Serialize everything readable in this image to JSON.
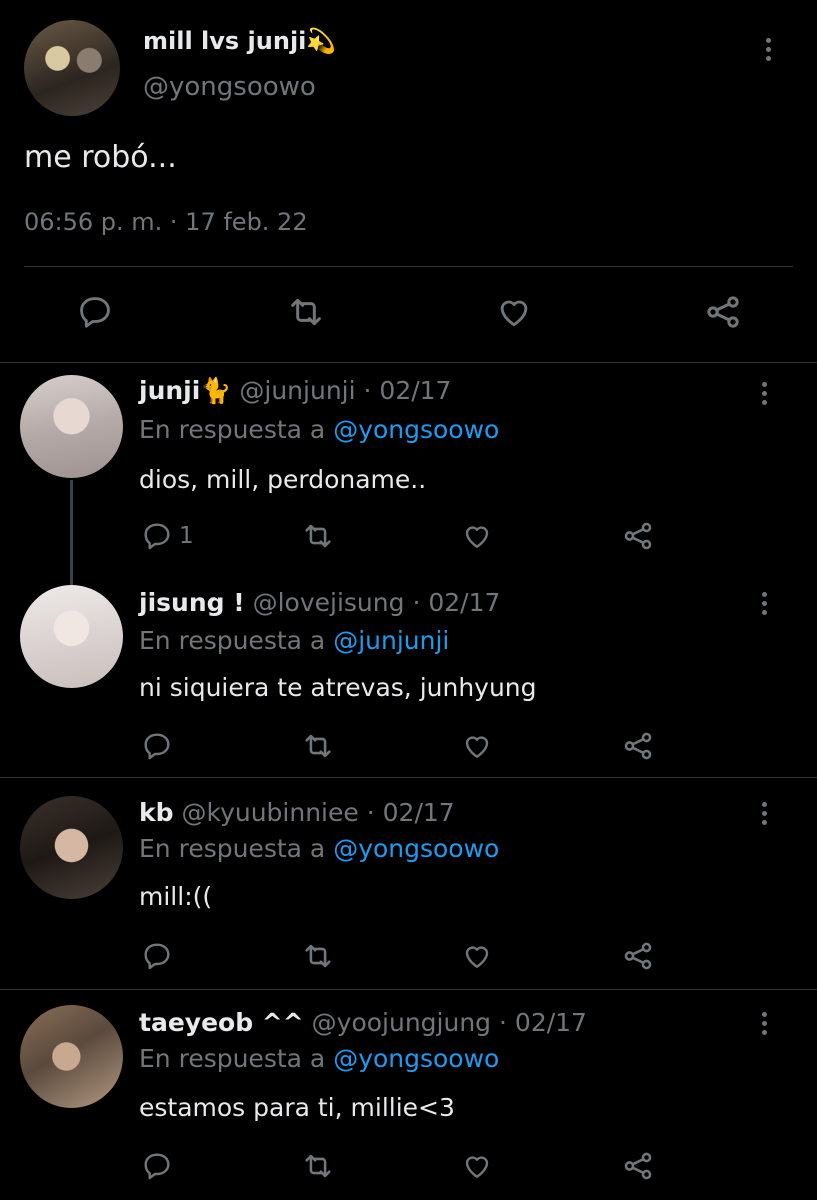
{
  "main_tweet": {
    "display_name": "mill lvs junji💫",
    "handle": "@yongsoowo",
    "text": "me robó...",
    "timestamp": "06:56 p. m. · 17 feb. 22",
    "actions": [
      "reply-icon",
      "retweet-icon",
      "like-icon",
      "share-icon"
    ]
  },
  "replies": [
    {
      "name": "junji🐈",
      "handle": "@junjunji",
      "date": "· 02/17",
      "in_reply_label": "En respuesta a",
      "in_reply_to": "@yongsoowo",
      "text": "dios, mill, perdoname..",
      "reply_count": "1"
    },
    {
      "name": "jisung !",
      "handle": "@lovejisung",
      "date": "· 02/17",
      "in_reply_label": "En respuesta a",
      "in_reply_to": "@junjunji",
      "text": "ni siquiera te atrevas, junhyung",
      "reply_count": ""
    },
    {
      "name": "kb",
      "handle": "@kyuubinniee",
      "date": "· 02/17",
      "in_reply_label": "En respuesta a",
      "in_reply_to": "@yongsoowo",
      "text": "mill:((",
      "reply_count": ""
    },
    {
      "name": "taeyeob ^^",
      "handle": "@yoojungjung",
      "date": "· 02/17",
      "in_reply_label": "En respuesta a",
      "in_reply_to": "@yongsoowo",
      "text": "estamos para ti, millie<3",
      "reply_count": ""
    }
  ],
  "colors": {
    "background": "#000000",
    "text": "#e7e9ea",
    "muted": "#71767b",
    "link": "#1d9bf0",
    "divider": "#2f3336"
  }
}
